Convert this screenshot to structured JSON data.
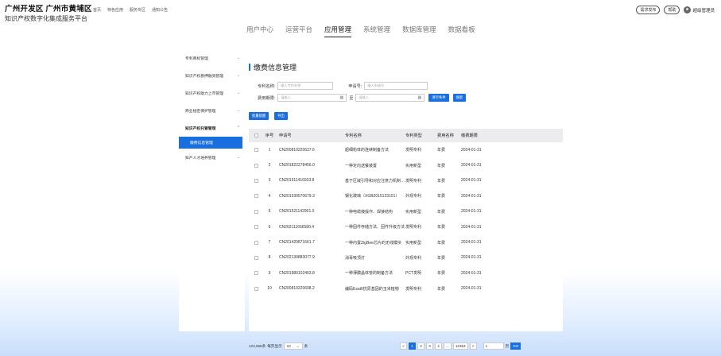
{
  "brand": {
    "title": "广州开发区 广州市黄埔区",
    "subtitle": "知识产权数字化集成服务平台"
  },
  "topnav": [
    "首页",
    "特色应用",
    "服务专区",
    "通知公告"
  ],
  "top_right": {
    "demand": "需求发布",
    "help": "帮助",
    "user": "超级管理员"
  },
  "mainnav": [
    {
      "label": "用户中心",
      "active": false
    },
    {
      "label": "运营平台",
      "active": false
    },
    {
      "label": "应用管理",
      "active": true
    },
    {
      "label": "系统管理",
      "active": false
    },
    {
      "label": "数据库管理",
      "active": false
    },
    {
      "label": "数据看板",
      "active": false
    }
  ],
  "sidebar": {
    "items": [
      {
        "label": "专利商标管理",
        "chevron": "⌄"
      },
      {
        "label": "知识产权质押融资管理",
        "chevron": "⌄"
      },
      {
        "label": "知识产权助力上市管理",
        "chevron": "⌄"
      },
      {
        "label": "商业秘密保护管理",
        "chevron": "⌄"
      },
      {
        "label": "知识产权托管管理",
        "chevron": "⌃"
      }
    ],
    "sub_active": "缴费信息管理",
    "last_item": {
      "label": "知产人才培养管理",
      "chevron": "⌄"
    }
  },
  "page": {
    "title": "缴费信息管理"
  },
  "filters": {
    "patent_name_label": "专利名称:",
    "patent_name_placeholder": "输入专利名称",
    "app_no_label": "申请号:",
    "app_no_placeholder": "输入申请号",
    "fee_date_label": "费用期限:",
    "date_placeholder_1": "请输入",
    "date_to": "至",
    "date_placeholder_2": "请输入",
    "clear_label": "清空条件",
    "search_label": "搜索",
    "batch_label": "批量提醒",
    "export_label": "导出"
  },
  "table": {
    "headers": {
      "no": "序号",
      "app": "申请号",
      "name": "专利名称",
      "type": "专利类型",
      "fee": "费用名称",
      "date": "缴费期限"
    },
    "rows": [
      {
        "no": "1",
        "app": "CN200810220637.6",
        "name": "超细粉体的连续制备方法",
        "type": "发明专利",
        "fee": "年费",
        "date": "2024-01-31"
      },
      {
        "no": "2",
        "app": "CN201822278456.0",
        "name": "一种定向送餐装置",
        "type": "实用新型",
        "fee": "年费",
        "date": "2024-01-31"
      },
      {
        "no": "3",
        "app": "CN201911416933.8",
        "name": "基于区域引导和对应注意力机制的方法",
        "type": "发明专利",
        "fee": "年费",
        "date": "2024-01-31"
      },
      {
        "no": "4",
        "app": "CN201530570679.3",
        "name": "钢化玻璃（XGB2015123101）",
        "type": "外观专利",
        "fee": "年费",
        "date": "2024-01-31"
      },
      {
        "no": "5",
        "app": "CN201521142901.0",
        "name": "一种电缆接操作、焊接结构",
        "type": "实用新型",
        "fee": "年费",
        "date": "2024-01-31"
      },
      {
        "no": "6",
        "app": "CN202111666580.4",
        "name": "一种固件存储方法、固件升级方法",
        "type": "发明专利",
        "fee": "年费",
        "date": "2024-01-31"
      },
      {
        "no": "7",
        "app": "CN201420871661.7",
        "name": "一种内置ZigBee芯片的无线模块",
        "type": "实用新型",
        "fee": "年费",
        "date": "2024-01-31"
      },
      {
        "no": "8",
        "app": "CN202130883077.9",
        "name": "消毒吸顶灯",
        "type": "外观专利",
        "fee": "年费",
        "date": "2024-01-31"
      },
      {
        "no": "9",
        "app": "CN201980102403.8",
        "name": "一种薄膜晶体管的制备方法",
        "type": "PCT发明",
        "fee": "年费",
        "date": "2024-01-31"
      },
      {
        "no": "10",
        "app": "CN200810220698.2",
        "name": "编码Esat6抗原基因的玉米植物",
        "type": "发明专利",
        "fee": "年费",
        "date": "2024-01-31"
      }
    ]
  },
  "pager": {
    "total": "123,658条",
    "per_page_label": "每页显示",
    "per_page_value": "10",
    "unit": "条",
    "prev": "<",
    "pages": [
      "1",
      "2",
      "3",
      "4"
    ],
    "ellipsis": "...",
    "last": "12364",
    "next": ">",
    "jump_value": "1",
    "jump_unit": "页",
    "go": "GO"
  }
}
